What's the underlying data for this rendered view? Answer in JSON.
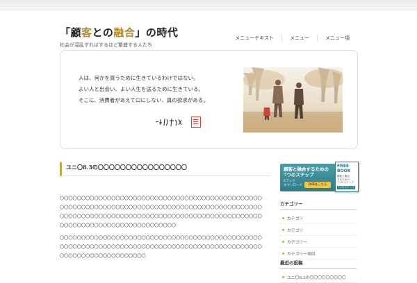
{
  "site": {
    "title_pre": "「顧",
    "title_hl1": "客",
    "title_mid": "との",
    "title_hl2": "融合",
    "title_post": "」の時代",
    "tagline": "社会が混乱すればするほど繁盛する人たち"
  },
  "nav": [
    "メニューテキスト",
    "メニュー",
    "メニュー項"
  ],
  "hero": {
    "lines": [
      "人は、何かを買うために生きているわけではない。",
      "よい人と出会い、よい人生を送るために生きている。",
      "そこに、消費者があえて口にしない、真の欲求がある。"
    ]
  },
  "post": {
    "title": "ユニ〇8.3の〇〇〇〇〇〇〇〇〇〇〇〇〇〇〇〇",
    "paragraphs": [
      "〇〇〇〇〇〇〇〇〇〇〇〇〇〇〇〇〇〇〇〇〇〇〇〇〇〇〇〇〇〇〇〇〇〇〇〇〇〇〇〇〇〇〇〇〇〇〇〇〇〇〇〇〇〇〇〇〇〇〇〇〇〇〇〇〇〇〇〇〇〇〇〇〇〇〇〇〇〇〇〇〇〇〇〇〇〇〇〇〇〇〇〇〇〇〇〇〇〇〇〇〇〇〇〇〇〇〇〇〇〇〇〇〇〇〇〇〇〇〇〇〇〇〇〇〇〇〇〇〇〇〇〇〇〇〇〇〇〇〇〇〇〇〇〇〇〇〇〇〇〇〇〇〇〇〇〇〇〇〇〇〇〇〇〇〇〇〇〇",
      "〇〇〇〇〇〇〇〇〇〇〇〇〇〇〇〇〇〇〇〇〇〇〇〇〇〇〇〇〇〇〇〇〇〇〇〇〇〇〇〇〇〇〇〇〇〇〇〇〇〇〇〇〇〇〇〇〇〇〇〇〇〇〇〇〇〇〇〇〇〇〇〇〇〇〇〇〇〇〇〇〇〇〇〇〇〇〇〇〇〇〇〇〇〇〇〇〇〇〇〇〇〇〇〇〇〇〇〇〇〇〇〇〇〇"
    ]
  },
  "banner": {
    "title_line1": "顧客と融合するための",
    "title_line2": "7つのステップ",
    "sub_line1": "Eブック",
    "sub_line2": "ダウンロード",
    "button": "詳細はこちら",
    "book_line1": "FREE",
    "book_line2": "BOOK",
    "book_desc1": "顧客と融合",
    "book_desc2": "するための",
    "book_desc3": "7つのステップ",
    "book_tag": "7つのステップ"
  },
  "sidebar": {
    "widget1": {
      "title": "カテゴリー",
      "items": [
        "カテゴリ",
        "カテゴリ",
        "カテゴリー",
        "カテゴリー項目"
      ]
    },
    "widget2": {
      "title": "最近の投稿",
      "items": [
        "ユニ〇8.3の〇〇〇〇〇〇〇〇〇"
      ]
    }
  }
}
